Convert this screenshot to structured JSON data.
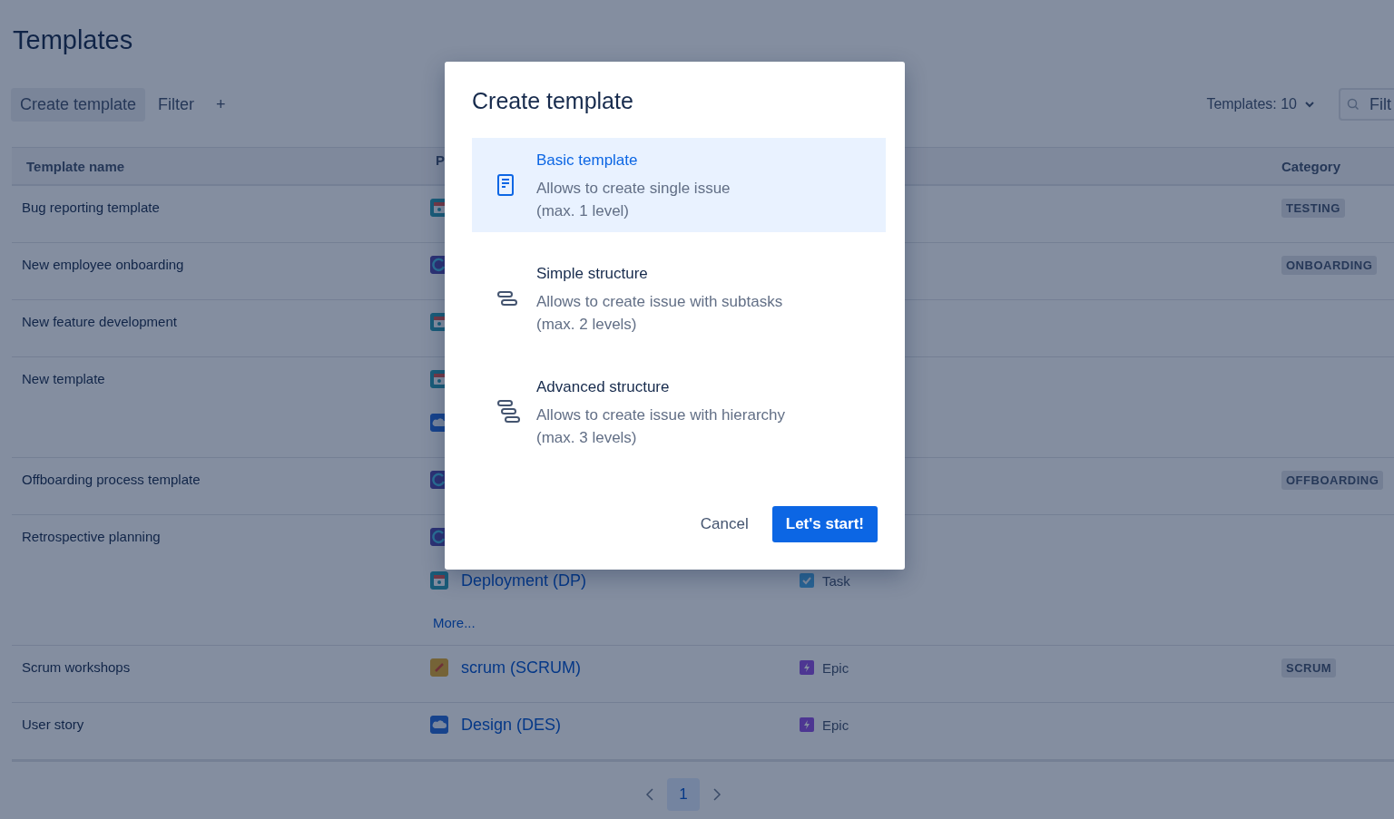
{
  "page": {
    "title": "Templates"
  },
  "toolbar": {
    "create_button": "Create template",
    "filter_button": "Filter",
    "add_button": "+",
    "count_dropdown": "Templates: 10",
    "search": {
      "placeholder": "Filt"
    }
  },
  "table": {
    "columns": [
      "Template name",
      "P",
      "Category"
    ],
    "rows": [
      {
        "name": "Bug reporting template",
        "projects": [
          {
            "kind": "calendar"
          }
        ],
        "issue_types": [],
        "category": "TESTING"
      },
      {
        "name": "New employee onboarding",
        "projects": [
          {
            "kind": "cycle"
          }
        ],
        "issue_types": [],
        "category": "ONBOARDING"
      },
      {
        "name": "New feature development",
        "projects": [
          {
            "kind": "calendar"
          }
        ],
        "issue_types": []
      },
      {
        "name": "New template",
        "projects": [
          {
            "kind": "calendar"
          },
          {
            "kind": "cloud"
          }
        ],
        "issue_types": []
      },
      {
        "name": "Offboarding process template",
        "projects": [
          {
            "kind": "cycle"
          }
        ],
        "issue_types": [],
        "category": "OFFBOARDING"
      },
      {
        "name": "Retrospective planning",
        "projects": [
          {
            "kind": "cycle"
          },
          {
            "kind": "calendar",
            "name": "Deployment (DP)"
          }
        ],
        "issue_types": [
          {
            "kind": "none"
          },
          {
            "kind": "task",
            "label": "Task"
          }
        ],
        "more_link": "More..."
      },
      {
        "name": "Scrum workshops",
        "projects": [
          {
            "kind": "pencil",
            "name": "scrum (SCRUM)"
          }
        ],
        "issue_types": [
          {
            "kind": "epic",
            "label": "Epic"
          }
        ],
        "category": "SCRUM"
      },
      {
        "name": "User story",
        "projects": [
          {
            "kind": "cloud",
            "name": "Design (DES)"
          }
        ],
        "issue_types": [
          {
            "kind": "epic",
            "label": "Epic"
          }
        ]
      }
    ]
  },
  "pagination": {
    "pages": [
      {
        "label": "1",
        "selected": true
      }
    ]
  },
  "dialog": {
    "title": "Create template",
    "options": [
      {
        "kind": "basic",
        "title": "Basic template",
        "description": "Allows to create single issue",
        "note": "(max. 1 level)",
        "selected": true
      },
      {
        "kind": "simple",
        "title": "Simple structure",
        "description": "Allows to create issue with subtasks",
        "note": "(max. 2 levels)",
        "selected": false
      },
      {
        "kind": "advanced",
        "title": "Advanced structure",
        "description": "Allows to create issue with hierarchy",
        "note": "(max. 3 levels)",
        "selected": false
      }
    ],
    "buttons": {
      "cancel": "Cancel",
      "confirm": "Let's start!"
    }
  }
}
